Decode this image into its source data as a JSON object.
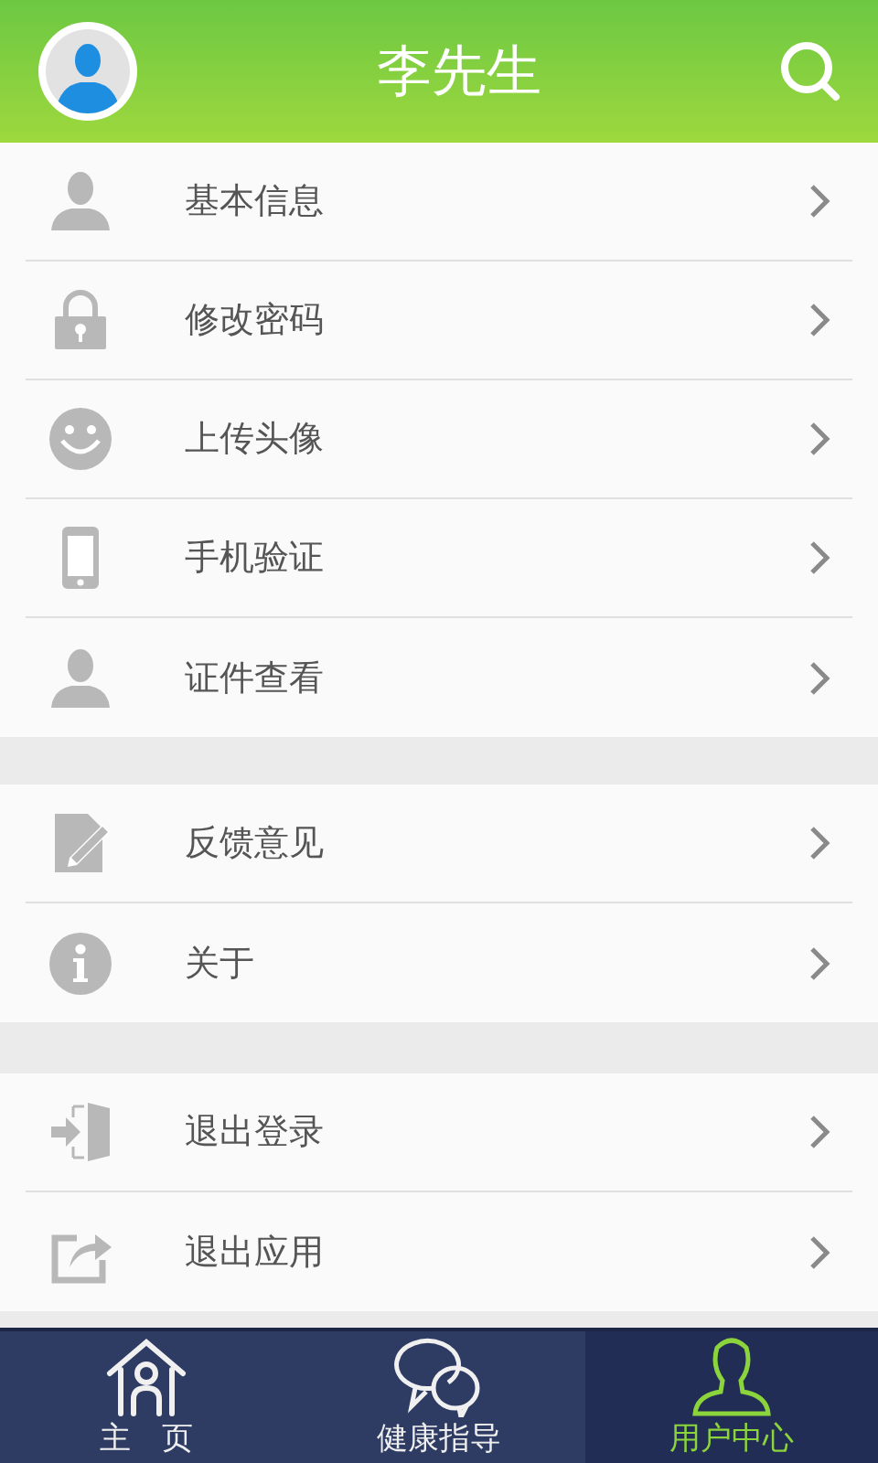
{
  "header": {
    "title": "李先生"
  },
  "groups": [
    {
      "items": [
        {
          "kind": "person",
          "label": "基本信息"
        },
        {
          "kind": "lock",
          "label": "修改密码"
        },
        {
          "kind": "smile",
          "label": "上传头像"
        },
        {
          "kind": "phone",
          "label": "手机验证"
        },
        {
          "kind": "person",
          "label": "证件查看"
        }
      ]
    },
    {
      "items": [
        {
          "kind": "edit",
          "label": "反馈意见"
        },
        {
          "kind": "info",
          "label": "关于"
        }
      ]
    },
    {
      "items": [
        {
          "kind": "door",
          "label": "退出登录"
        },
        {
          "kind": "share",
          "label": "退出应用"
        }
      ]
    }
  ],
  "tabs": [
    {
      "kind": "home",
      "label": "主　页",
      "selected": false
    },
    {
      "kind": "chat",
      "label": "健康指导",
      "selected": false
    },
    {
      "kind": "user",
      "label": "用户中心",
      "selected": true
    }
  ]
}
